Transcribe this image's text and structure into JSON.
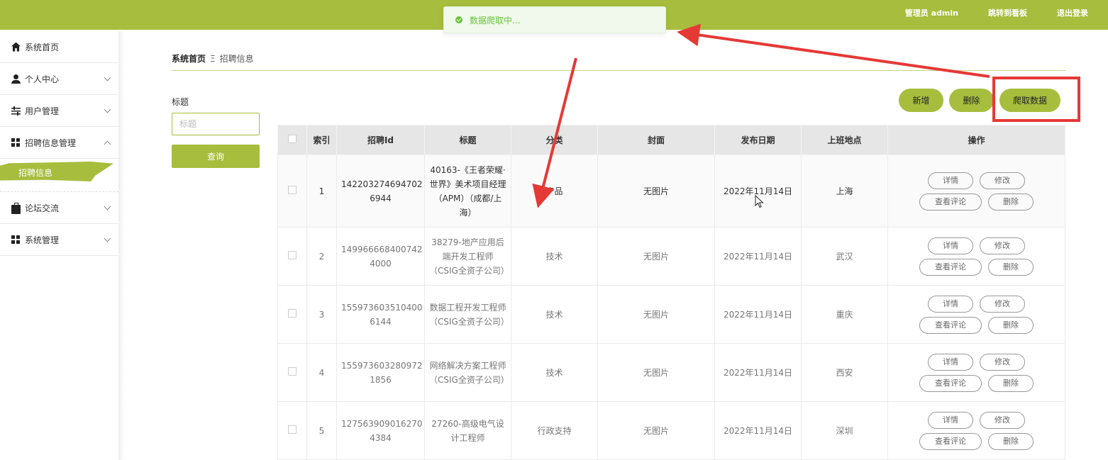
{
  "header": {
    "admin_label": "管理员 admin",
    "dashboard_link": "跳转到看板",
    "logout_link": "退出登录",
    "bg_color": "#a7bd3d"
  },
  "toast": {
    "message": "数据爬取中..."
  },
  "sidebar": {
    "items": [
      {
        "label": "系统首页",
        "icon": "home-icon"
      },
      {
        "label": "个人中心",
        "icon": "user-icon"
      },
      {
        "label": "用户管理",
        "icon": "sliders-icon"
      },
      {
        "label": "招聘信息管理",
        "icon": "grid-icon"
      },
      {
        "label": "招聘信息",
        "icon": ""
      },
      {
        "label": "论坛交流",
        "icon": "briefcase-icon"
      },
      {
        "label": "系统管理",
        "icon": "grid-icon"
      }
    ]
  },
  "breadcrumb": {
    "home": "系统首页",
    "separator": "Ξ",
    "current": "招聘信息"
  },
  "search": {
    "label": "标题",
    "placeholder": "标题",
    "button": "查询"
  },
  "toolbar": {
    "add": "新增",
    "delete": "删除",
    "crawl": "爬取数据"
  },
  "table": {
    "headers": [
      "索引",
      "招聘Id",
      "标题",
      "分类",
      "封面",
      "发布日期",
      "上班地点",
      "操作"
    ],
    "rows": [
      {
        "index": "1",
        "id": "142203274694702 6944",
        "title": "40163-《王者荣耀·世界》美术项目经理（APM）（成都/上海）",
        "category": "产品",
        "cover": "无图片",
        "date": "2022年11月14日",
        "location": "上海"
      },
      {
        "index": "2",
        "id": "149966668400742 4000",
        "title": "38279-地产应用后端开发工程师（CSIG全资子公司）",
        "category": "技术",
        "cover": "无图片",
        "date": "2022年11月14日",
        "location": "武汉"
      },
      {
        "index": "3",
        "id": "155973603510400 6144",
        "title": "数据工程开发工程师（CSIG全资子公司）",
        "category": "技术",
        "cover": "无图片",
        "date": "2022年11月14日",
        "location": "重庆"
      },
      {
        "index": "4",
        "id": "155973603280972 1856",
        "title": "网络解决方案工程师（CSIG全资子公司）",
        "category": "技术",
        "cover": "无图片",
        "date": "2022年11月14日",
        "location": "西安"
      },
      {
        "index": "5",
        "id": "127563909016270 4384",
        "title": "27260-高级电气设计工程师",
        "category": "行政支持",
        "cover": "无图片",
        "date": "2022年11月14日",
        "location": "深圳"
      }
    ],
    "actions": {
      "detail": "详情",
      "edit": "修改",
      "comments": "查看评论",
      "delete": "删除"
    }
  },
  "colors": {
    "accent": "#a7bd3d",
    "annotation": "#e53935",
    "toast_text": "#67c23a"
  }
}
